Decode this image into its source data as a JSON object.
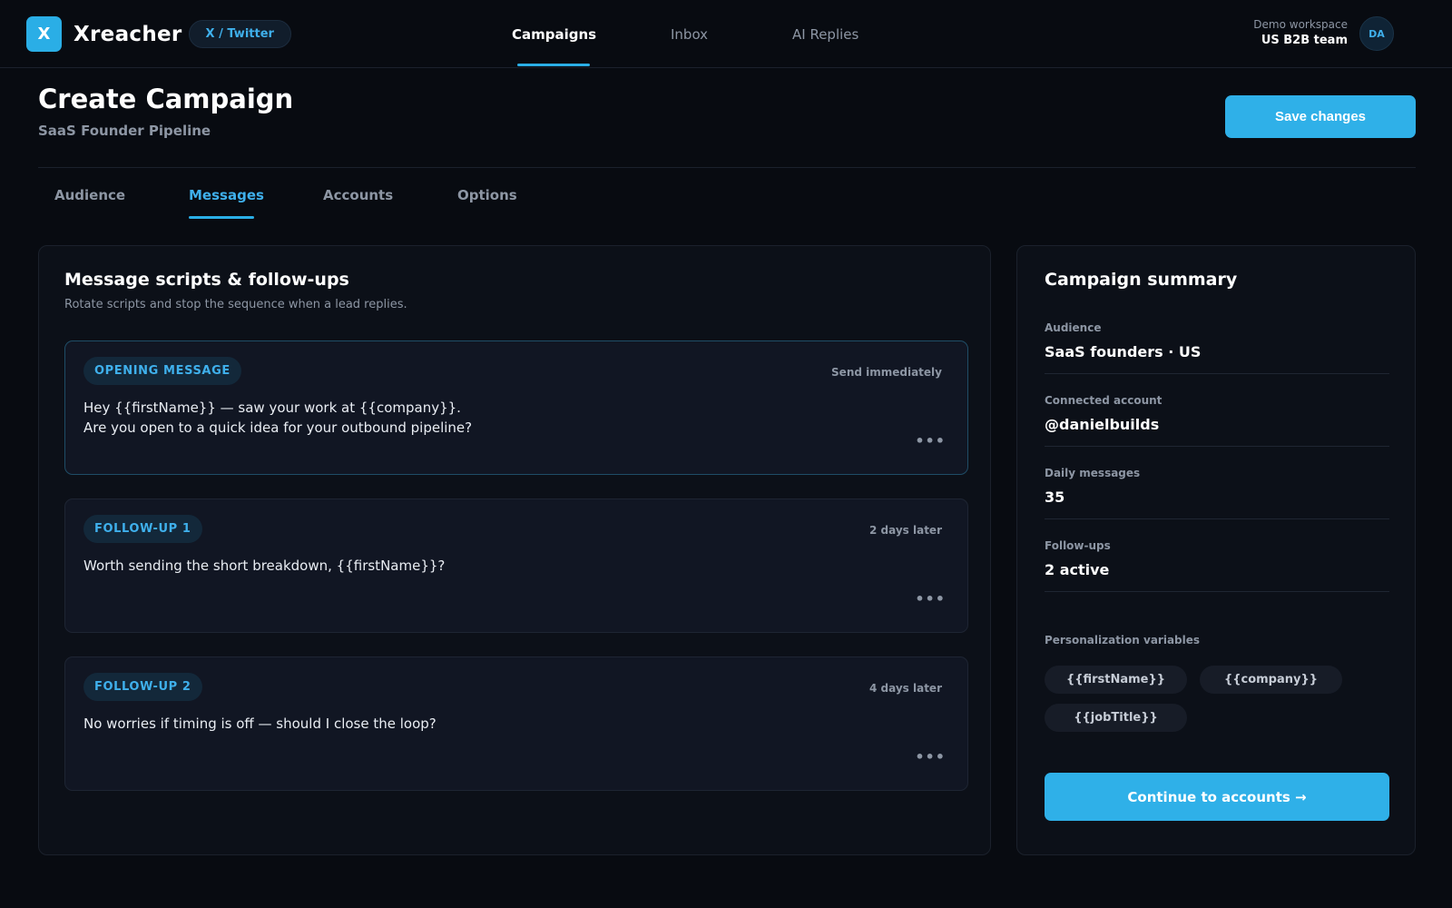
{
  "app": {
    "logo_letter": "X",
    "name": "Xreacher",
    "platform_badge": "X / Twitter"
  },
  "nav": {
    "tabs": [
      {
        "label": "Campaigns",
        "active": true
      },
      {
        "label": "Inbox",
        "active": false
      },
      {
        "label": "AI Replies",
        "active": false
      }
    ]
  },
  "workspace": {
    "label": "Demo workspace",
    "name": "US B2B team",
    "avatar_initials": "DA"
  },
  "page": {
    "title": "Create Campaign",
    "subtitle": "SaaS Founder Pipeline",
    "save_label": "Save changes"
  },
  "sub_tabs": [
    {
      "label": "Audience",
      "active": false
    },
    {
      "label": "Messages",
      "active": true
    },
    {
      "label": "Accounts",
      "active": false
    },
    {
      "label": "Options",
      "active": false
    }
  ],
  "messages_panel": {
    "title": "Message scripts & follow-ups",
    "description": "Rotate scripts and stop the sequence when a lead replies.",
    "more_label": "•••",
    "cards": [
      {
        "badge": "OPENING MESSAGE",
        "timing": "Send immediately",
        "lines": [
          "Hey {{firstName}} — saw your work at {{company}}.",
          "Are you open to a quick idea for your outbound pipeline?"
        ]
      },
      {
        "badge": "FOLLOW-UP 1",
        "timing": "2 days later",
        "lines": [
          "Worth sending the short breakdown, {{firstName}}?",
          ""
        ]
      },
      {
        "badge": "FOLLOW-UP 2",
        "timing": "4 days later",
        "lines": [
          "No worries if timing is off — should I close the loop?",
          ""
        ]
      }
    ]
  },
  "summary": {
    "title": "Campaign summary",
    "rows": [
      {
        "label": "Audience",
        "value": "SaaS founders · US"
      },
      {
        "label": "Connected account",
        "value": "@danielbuilds"
      },
      {
        "label": "Daily messages",
        "value": "35"
      },
      {
        "label": "Follow-ups",
        "value": "2 active"
      }
    ],
    "variables_label": "Personalization variables",
    "variables": [
      "{{firstName}}",
      "{{company}}",
      "{{jobTitle}}"
    ],
    "continue_label": "Continue to accounts →"
  },
  "colors": {
    "accent": "#2fb0e8",
    "background": "#080b11",
    "panel": "#0c1018"
  }
}
